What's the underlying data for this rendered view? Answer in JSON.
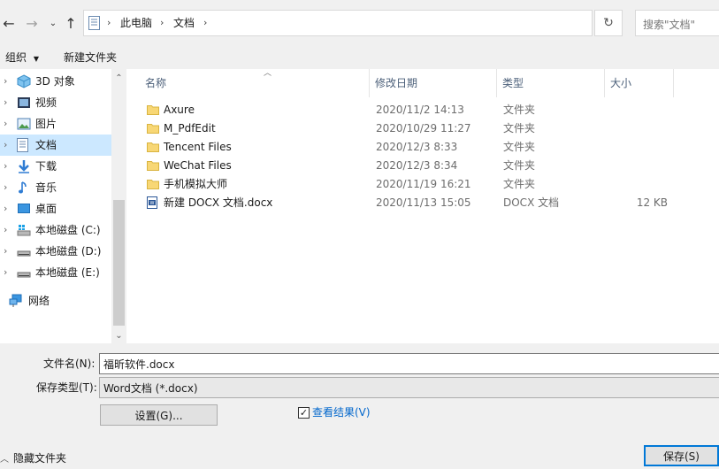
{
  "address": {
    "breadcrumb": [
      "此电脑",
      "文档"
    ],
    "search_placeholder": "搜索\"文档\""
  },
  "toolbar": {
    "organize": "组织",
    "new_folder": "新建文件夹"
  },
  "nav": [
    {
      "label": "3D 对象",
      "icon": "3d-objects-icon"
    },
    {
      "label": "视频",
      "icon": "video-icon"
    },
    {
      "label": "图片",
      "icon": "pictures-icon"
    },
    {
      "label": "文档",
      "icon": "documents-icon",
      "selected": true
    },
    {
      "label": "下载",
      "icon": "download-icon"
    },
    {
      "label": "音乐",
      "icon": "music-icon"
    },
    {
      "label": "桌面",
      "icon": "desktop-icon"
    },
    {
      "label": "本地磁盘 (C:)",
      "icon": "windows-drive-icon"
    },
    {
      "label": "本地磁盘 (D:)",
      "icon": "drive-icon"
    },
    {
      "label": "本地磁盘 (E:)",
      "icon": "drive-icon"
    },
    {
      "label": "网络",
      "icon": "network-icon"
    }
  ],
  "columns": {
    "name": "名称",
    "modified": "修改日期",
    "type": "类型",
    "size": "大小"
  },
  "files": [
    {
      "name": "Axure",
      "modified": "2020/11/2 14:13",
      "type": "文件夹",
      "size": "",
      "icon": "folder-icon"
    },
    {
      "name": "M_PdfEdit",
      "modified": "2020/10/29 11:27",
      "type": "文件夹",
      "size": "",
      "icon": "folder-icon"
    },
    {
      "name": "Tencent Files",
      "modified": "2020/12/3 8:33",
      "type": "文件夹",
      "size": "",
      "icon": "folder-icon"
    },
    {
      "name": "WeChat Files",
      "modified": "2020/12/3 8:34",
      "type": "文件夹",
      "size": "",
      "icon": "folder-icon"
    },
    {
      "name": "手机模拟大师",
      "modified": "2020/11/19 16:21",
      "type": "文件夹",
      "size": "",
      "icon": "folder-icon"
    },
    {
      "name": "新建 DOCX 文档.docx",
      "modified": "2020/11/13 15:05",
      "type": "DOCX 文档",
      "size": "12 KB",
      "icon": "docx-file-icon"
    }
  ],
  "form": {
    "filename_label": "文件名(N):",
    "filename_value": "福昕软件.docx",
    "filetype_label": "保存类型(T):",
    "filetype_value": "Word文档 (*.docx)",
    "settings_button": "设置(G)...",
    "view_results_label": "查看结果(V)",
    "view_results_checked": true,
    "hide_folders": "隐藏文件夹",
    "save_button": "保存(S)"
  },
  "colors": {
    "selection": "#cce8ff",
    "link": "#0066cc",
    "folder": "#f8d775",
    "accent": "#0078d7"
  }
}
